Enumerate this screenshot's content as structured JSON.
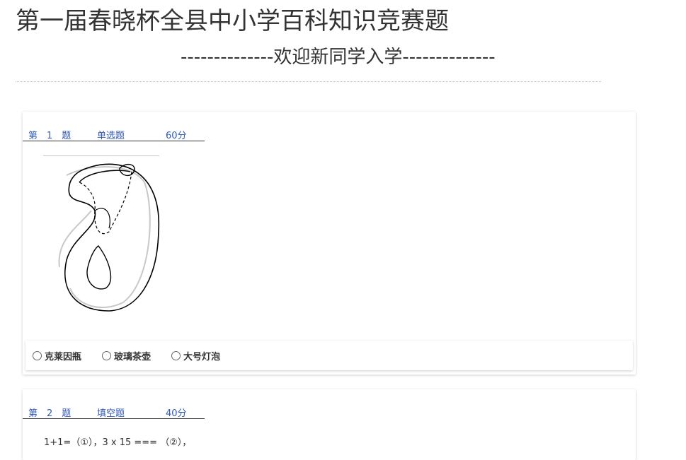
{
  "header": {
    "title": "第一届春晓杯全县中小学百科知识竞赛题",
    "subtitle": "--------------欢迎新同学入学--------------"
  },
  "questions": [
    {
      "number_label": "第　1　题",
      "type_label": "单选题",
      "score_label": "60分",
      "figure_icon": "klein-bottle-figure",
      "options": [
        "克莱因瓶",
        "玻璃茶壶",
        "大号灯泡"
      ]
    },
    {
      "number_label": "第　2　题",
      "type_label": "填空题",
      "score_label": "40分",
      "text": "1+1=（①），3 x 15 === （②），"
    }
  ]
}
